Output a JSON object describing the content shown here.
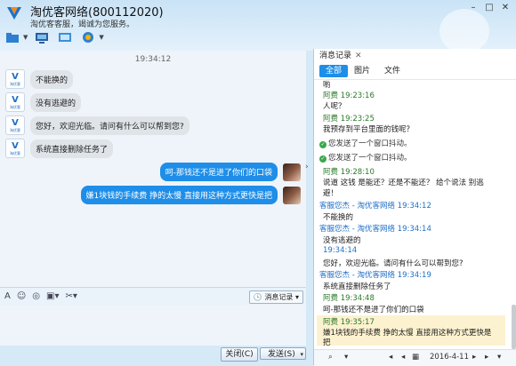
{
  "window": {
    "title": "淘优客网络(800112020)",
    "subtitle": "淘优客客服，竭诚为您服务。",
    "logo_text": "淘优客"
  },
  "chat": {
    "time_header": "19:34:12",
    "incoming": [
      "不能换的",
      "没有逃避的",
      "您好，欢迎光临。请问有什么可以帮到您?",
      "系统直接删除任务了"
    ],
    "outgoing": [
      "呵-那钱还不是进了你们的口袋",
      "嫌1块钱的手续费 挣的太慢 直接用这种方式更快是把"
    ]
  },
  "input_toolbar": {
    "history_button": "消息记录"
  },
  "buttons": {
    "close": "关闭(C)",
    "send": "发送(S)"
  },
  "history": {
    "tab_label": "消息记录",
    "filters": [
      "全部",
      "图片",
      "文件"
    ],
    "active_filter": "全部",
    "entries": [
      {
        "kind": "text",
        "text": "喲"
      },
      {
        "kind": "name",
        "text": "阿费 19:23:16"
      },
      {
        "kind": "text",
        "text": "人呢？"
      },
      {
        "kind": "name",
        "text": "阿费 19:23:25"
      },
      {
        "kind": "text",
        "text": "我预存到平台里面的钱呢？"
      },
      {
        "kind": "sys",
        "text": "您发送了一个窗口抖动。"
      },
      {
        "kind": "sys",
        "text": "您发送了一个窗口抖动。"
      },
      {
        "kind": "name",
        "text": "阿费 19:28:10"
      },
      {
        "kind": "text",
        "text": "说道 这钱 是能还？还是不能还？ 给个说法 别逃"
      },
      {
        "kind": "text",
        "text": "避！"
      },
      {
        "kind": "name_blue",
        "text": "客服您杰 - 淘优客网络 19:34:12"
      },
      {
        "kind": "text",
        "text": "不能换的"
      },
      {
        "kind": "name_blue",
        "text": "客服您杰 - 淘优客网络 19:34:14"
      },
      {
        "kind": "text",
        "text": "没有逃避的"
      },
      {
        "kind": "name_blue",
        "text": "19:34:14"
      },
      {
        "kind": "text",
        "text": "您好，欢迎光临。请问有什么可以帮到您?"
      },
      {
        "kind": "name_blue",
        "text": "客服您杰 - 淘优客网络 19:34:19"
      },
      {
        "kind": "text",
        "text": "系统直接删除任务了"
      },
      {
        "kind": "name",
        "text": "阿费 19:34:48"
      },
      {
        "kind": "text",
        "text": "呵-那钱还不是进了你们的口袋"
      },
      {
        "kind": "name",
        "text": "阿费 19:35:17"
      },
      {
        "kind": "text",
        "text": "嫌1块钱的手续费 挣的太慢 直接用这种方式更快是"
      },
      {
        "kind": "text",
        "text": "把"
      }
    ],
    "footer_date": "2016-4-11"
  }
}
